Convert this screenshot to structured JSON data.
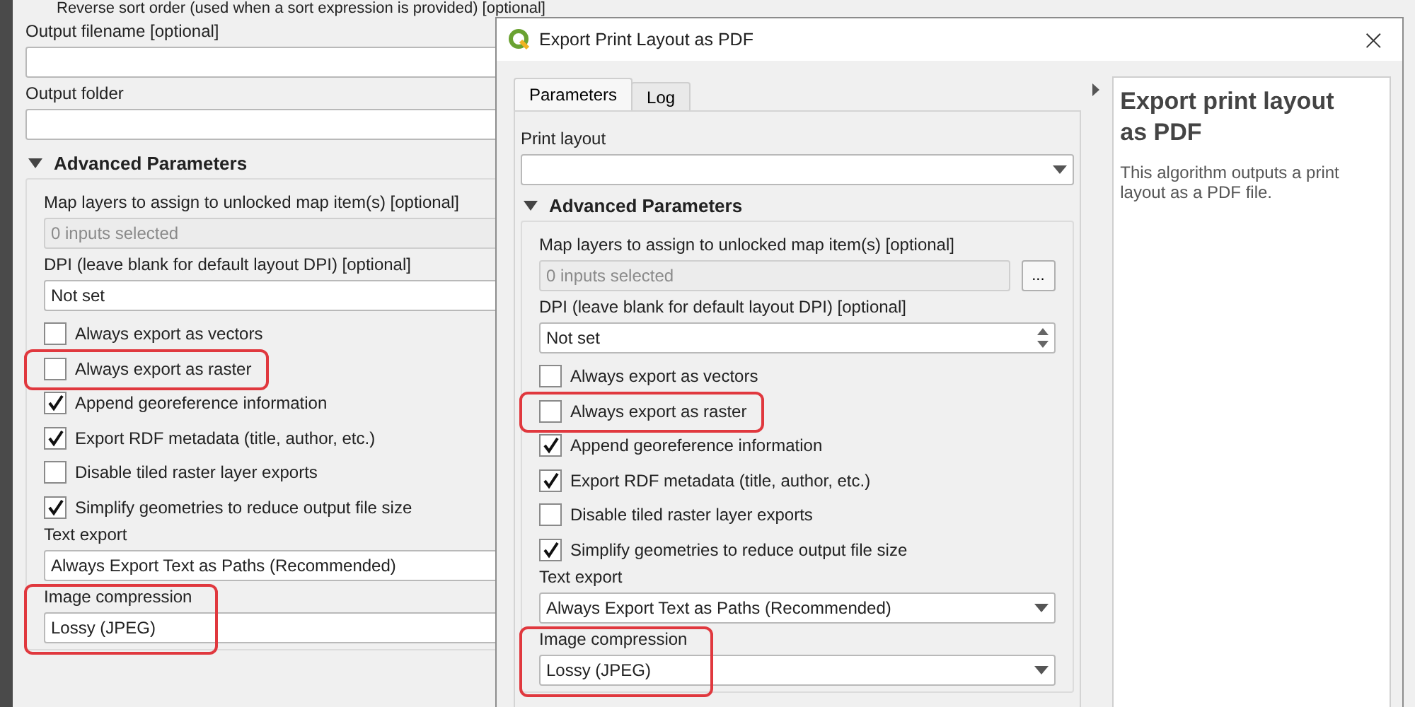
{
  "background_window": {
    "top_text": "Reverse sort order (used when a sort expression is provided) [optional]",
    "fields": [
      {
        "kind": "text",
        "label": "Output filename [optional]"
      },
      {
        "kind": "text",
        "label": "Output folder"
      }
    ],
    "advanced": {
      "title": "Advanced Parameters",
      "expanded": true,
      "items": [
        {
          "kind": "multi",
          "label": "Map layers to assign to unlocked map item(s) [optional]",
          "placeholder": "0 inputs selected"
        },
        {
          "kind": "spin",
          "label": "DPI (leave blank for default layout DPI) [optional]",
          "value": "Not set"
        },
        {
          "kind": "checkbox",
          "label": "Always export as vectors",
          "checked": false,
          "highlighted": false
        },
        {
          "kind": "checkbox",
          "label": "Always export as raster",
          "checked": false,
          "highlighted": true
        },
        {
          "kind": "checkbox",
          "label": "Append georeference information",
          "checked": true,
          "highlighted": false
        },
        {
          "kind": "checkbox",
          "label": "Export RDF metadata (title, author, etc.)",
          "checked": true,
          "highlighted": false
        },
        {
          "kind": "checkbox",
          "label": "Disable tiled raster layer exports",
          "checked": false,
          "highlighted": false
        },
        {
          "kind": "checkbox",
          "label": "Simplify geometries to reduce output file size",
          "checked": true,
          "highlighted": false
        },
        {
          "kind": "combo",
          "label": "Text export",
          "value": "Always Export Text as Paths (Recommended)",
          "highlighted": false
        },
        {
          "kind": "combo",
          "label": "Image compression",
          "value": "Lossy (JPEG)",
          "highlighted": true
        }
      ]
    }
  },
  "dialog": {
    "title": "Export Print Layout as PDF",
    "close": "×",
    "tabs": [
      {
        "label": "Parameters",
        "selected": true
      },
      {
        "label": "Log",
        "selected": false
      }
    ],
    "fields": [
      {
        "kind": "combo",
        "label": "Print layout"
      }
    ],
    "advanced": {
      "title": "Advanced Parameters",
      "expanded": true,
      "items": [
        {
          "kind": "multi",
          "label": "Map layers to assign to unlocked map item(s) [optional]",
          "placeholder": "0 inputs selected",
          "button": "..."
        },
        {
          "kind": "spin",
          "label": "DPI (leave blank for default layout DPI) [optional]",
          "value": "Not set"
        },
        {
          "kind": "checkbox",
          "label": "Always export as vectors",
          "checked": false,
          "highlighted": false
        },
        {
          "kind": "checkbox",
          "label": "Always export as raster",
          "checked": false,
          "highlighted": true
        },
        {
          "kind": "checkbox",
          "label": "Append georeference information",
          "checked": true,
          "highlighted": false
        },
        {
          "kind": "checkbox",
          "label": "Export RDF metadata (title, author, etc.)",
          "checked": true,
          "highlighted": false
        },
        {
          "kind": "checkbox",
          "label": "Disable tiled raster layer exports",
          "checked": false,
          "highlighted": false
        },
        {
          "kind": "checkbox",
          "label": "Simplify geometries to reduce output file size",
          "checked": true,
          "highlighted": false
        },
        {
          "kind": "combo",
          "label": "Text export",
          "value": "Always Export Text as Paths (Recommended)",
          "highlighted": false
        },
        {
          "kind": "combo",
          "label": "Image compression",
          "value": "Lossy (JPEG)",
          "highlighted": true
        }
      ]
    },
    "help": {
      "title": "Export print layout as PDF",
      "body": "This algorithm outputs a print layout as a PDF file."
    }
  }
}
